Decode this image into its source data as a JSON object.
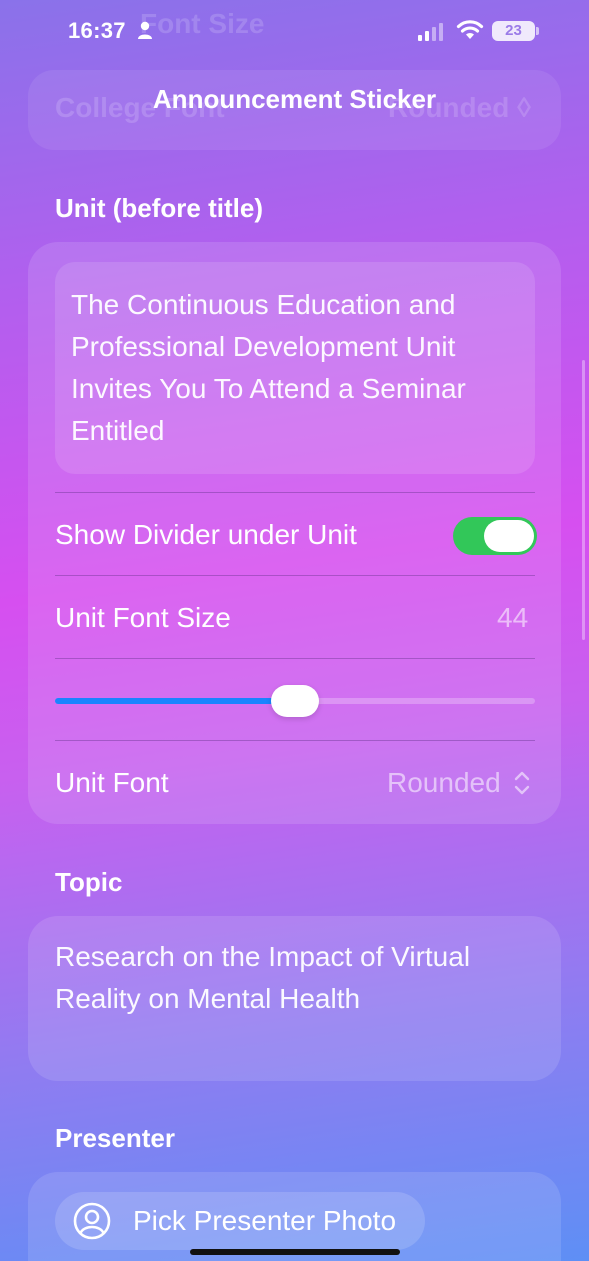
{
  "status_bar": {
    "time": "16:37",
    "battery": "23"
  },
  "ghost": {
    "line1": "Font Size",
    "line2": "College Font",
    "line3": "Rounded ◊"
  },
  "nav": {
    "title": "Announcement Sticker"
  },
  "unit_section": {
    "header": "Unit (before title)",
    "text": "The Continuous Education and Professional Development Unit Invites You To Attend a Seminar Entitled",
    "divider_label": "Show Divider under Unit",
    "divider_on": true,
    "font_size_label": "Unit Font Size",
    "font_size_value": "44",
    "slider_fraction": 0.5,
    "font_label": "Unit Font",
    "font_value": "Rounded"
  },
  "topic_section": {
    "header": "Topic",
    "text": "Research on the Impact of Virtual Reality on Mental Health"
  },
  "presenter_section": {
    "header": "Presenter",
    "pick_label": "Pick Presenter Photo"
  },
  "colors": {
    "toggle_on": "#32c759",
    "slider_fill": "#1a84ff"
  }
}
